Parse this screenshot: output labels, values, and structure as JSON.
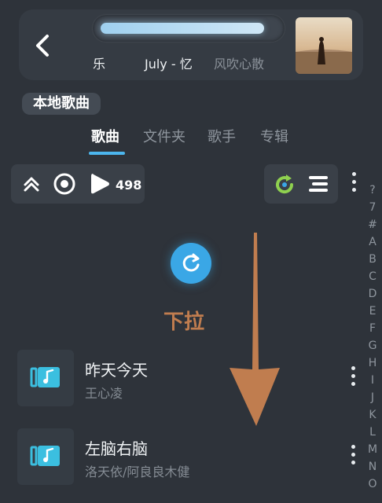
{
  "player": {
    "marquee_left": "乐",
    "marquee_center": "July - 忆",
    "marquee_right": "风吹心散",
    "progress_fraction": 0.93
  },
  "page_title": "本地歌曲",
  "tabs": [
    {
      "label": "歌曲",
      "active": true
    },
    {
      "label": "文件夹",
      "active": false
    },
    {
      "label": "歌手",
      "active": false
    },
    {
      "label": "专辑",
      "active": false
    }
  ],
  "toolbar": {
    "song_count": "498"
  },
  "alphabet": [
    "?",
    "7",
    "#",
    "A",
    "B",
    "C",
    "D",
    "E",
    "F",
    "G",
    "H",
    "I",
    "J",
    "K",
    "L",
    "M",
    "N",
    "O"
  ],
  "pull_hint": "下拉",
  "songs": [
    {
      "title": "昨天今天",
      "artist": "王心凌"
    },
    {
      "title": "左脑右脑",
      "artist": "洛天依/阿良良木健"
    }
  ],
  "colors": {
    "background": "#2e333a",
    "accent": "#4cb6ee",
    "pull_hint": "#c07d4f",
    "arrow": "#c07d4f",
    "refresh_green": "#8fd14f"
  }
}
